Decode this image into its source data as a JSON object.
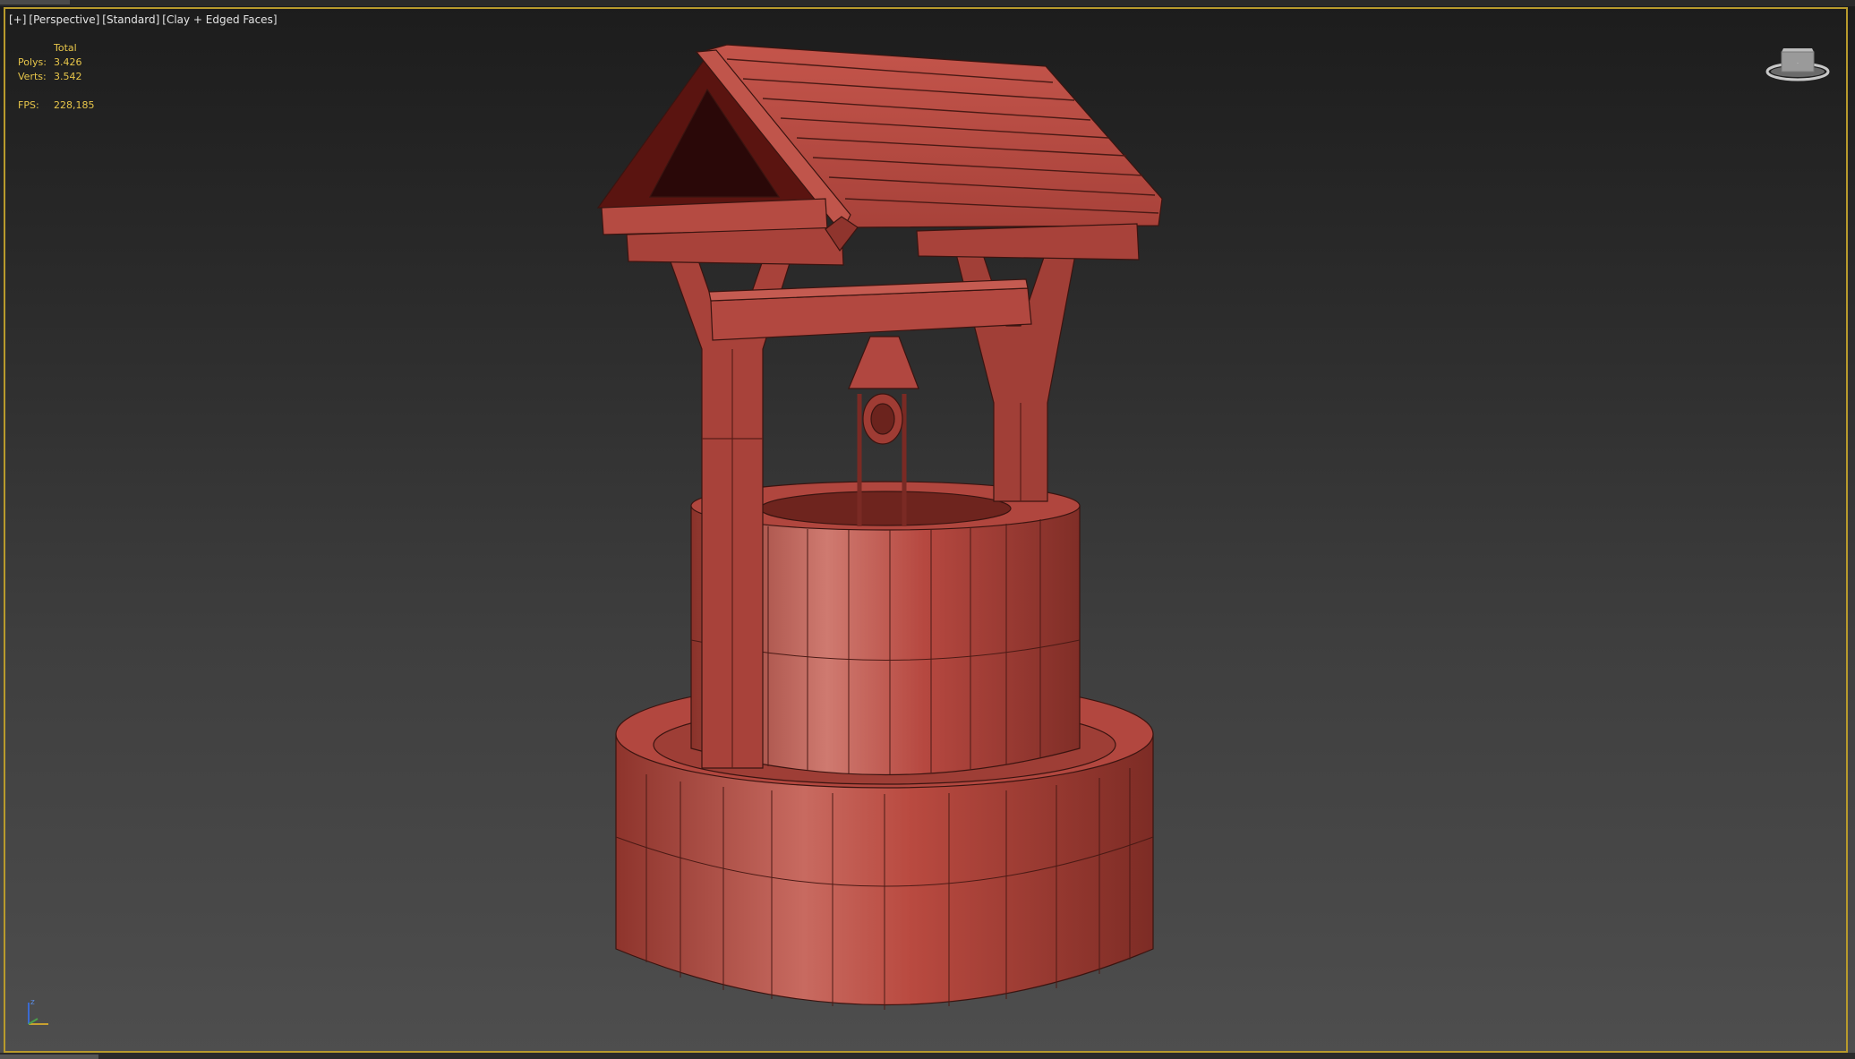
{
  "viewport": {
    "labels": [
      "[+]",
      "[Perspective]",
      "[Standard]",
      "[Clay + Edged Faces]"
    ],
    "stats": {
      "header": "Total",
      "polys_label": "Polys:",
      "polys_value": "3.426",
      "verts_label": "Verts:",
      "verts_value": "3.542",
      "fps_label": "FPS:",
      "fps_value": "228,185"
    },
    "axis_label": "z"
  },
  "colors": {
    "clay": "#b84a40",
    "clay_dark": "#7a2a24",
    "frame_border": "#b89a2c",
    "stats_text": "#e8c64a"
  },
  "icons": {
    "viewcube": "viewcube-icon",
    "axis": "axis-tripod-icon"
  }
}
